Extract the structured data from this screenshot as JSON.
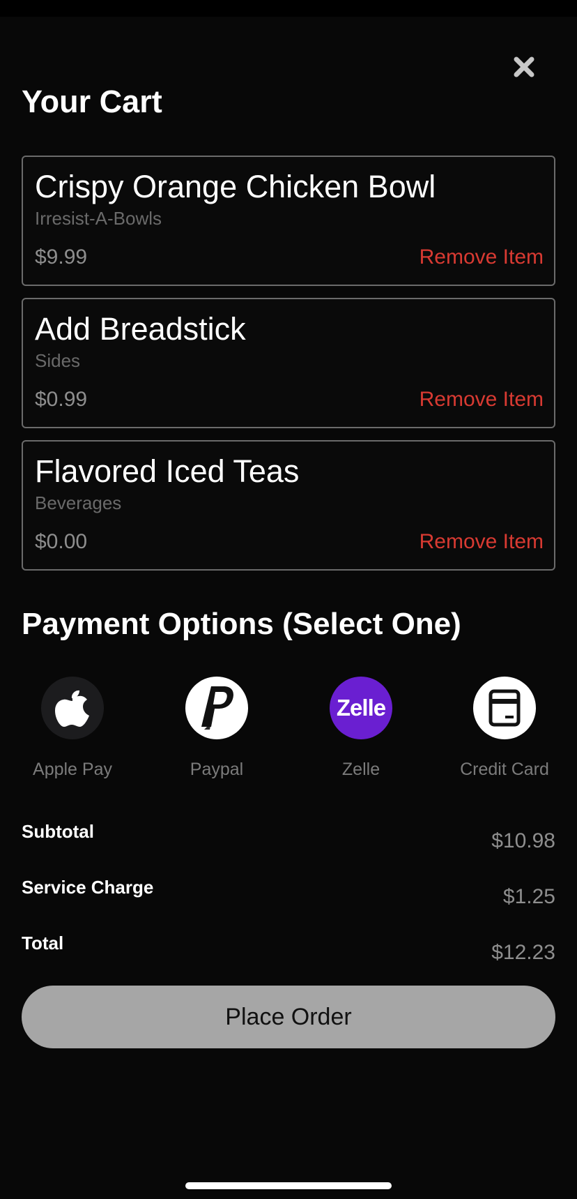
{
  "header": {
    "title": "Your Cart",
    "close_icon": "close-icon"
  },
  "cart": {
    "items": [
      {
        "name": "Crispy Orange Chicken Bowl",
        "category": "Irresist-A-Bowls",
        "price": "$9.99",
        "remove_label": "Remove Item"
      },
      {
        "name": "Add Breadstick",
        "category": "Sides",
        "price": "$0.99",
        "remove_label": "Remove Item"
      },
      {
        "name": "Flavored Iced Teas",
        "category": "Beverages",
        "price": "$0.00",
        "remove_label": "Remove Item"
      }
    ]
  },
  "payment": {
    "title": "Payment Options (Select One)",
    "options": [
      {
        "label": "Apple Pay",
        "icon": "apple-icon",
        "color": "#1c1c1e"
      },
      {
        "label": "Paypal",
        "icon": "paypal-icon",
        "color": "#ffffff"
      },
      {
        "label": "Zelle",
        "icon": "zelle-icon",
        "icon_text": "Zelle",
        "color": "#6a1fd1"
      },
      {
        "label": "Credit Card",
        "icon": "credit-card-icon",
        "color": "#ffffff"
      }
    ]
  },
  "summary": {
    "subtotal_label": "Subtotal",
    "subtotal_value": "$10.98",
    "service_label": "Service Charge",
    "service_value": "$1.25",
    "total_label": "Total",
    "total_value": "$12.23"
  },
  "actions": {
    "place_order_label": "Place Order"
  },
  "colors": {
    "background": "#080808",
    "card_border": "#6b6b6b",
    "remove": "#d83a32",
    "muted_text": "#8e8e8e",
    "button": "#a6a6a6"
  }
}
